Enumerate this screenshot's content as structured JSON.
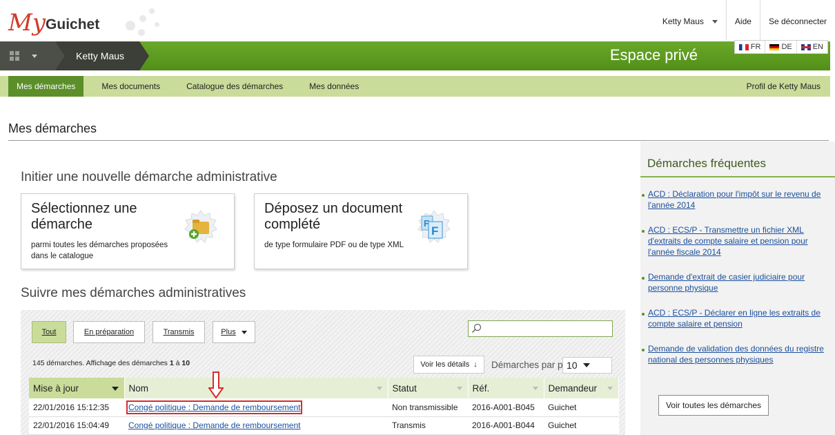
{
  "header": {
    "logo_my": "My",
    "logo_guichet": "Guichet",
    "user_name": "Ketty Maus",
    "help": "Aide",
    "logout": "Se déconnecter",
    "languages": [
      "FR",
      "DE",
      "EN"
    ]
  },
  "greenbar": {
    "user_pill": "Ketty Maus",
    "space_title": "Espace privé"
  },
  "nav": {
    "tabs": [
      "Mes démarches",
      "Mes documents",
      "Catalogue des démarches",
      "Mes données"
    ],
    "profile": "Profil de Ketty Maus"
  },
  "page_title": "Mes démarches",
  "new_section": {
    "heading": "Initier une nouvelle démarche administrative",
    "cards": [
      {
        "title": "Sélectionnez une démarche",
        "desc": "parmi toutes les démarches proposées dans le catalogue"
      },
      {
        "title": "Déposez un document complété",
        "desc": "de type formulaire PDF ou de type XML"
      }
    ]
  },
  "follow_section": {
    "heading": "Suivre mes démarches administratives",
    "filters": [
      "Tout",
      "En préparation",
      "Transmis",
      "Plus"
    ],
    "search_value": "",
    "count_prefix": "145 démarches. Affichage des démarches ",
    "count_from": "1",
    "count_sep": " à ",
    "count_to": "10",
    "details_btn": "Voir les détails",
    "per_page_label": "Démarches par page",
    "per_page_value": "10",
    "columns": [
      "Mise à jour",
      "Nom",
      "Statut",
      "Réf.",
      "Demandeur"
    ],
    "rows": [
      {
        "date": "22/01/2016 15:12:35",
        "name": "Congé politique : Demande de remboursement",
        "status": "Non transmissible",
        "ref": "2016-A001-B045",
        "requester": "Guichet"
      },
      {
        "date": "22/01/2016 15:04:49",
        "name": "Congé politique : Demande de remboursement",
        "status": "Transmis",
        "ref": "2016-A001-B044",
        "requester": "Guichet"
      }
    ]
  },
  "sidebar": {
    "title": "Démarches fréquentes",
    "links": [
      "ACD : Déclaration pour l'impôt sur le revenu de l'année 2014",
      "ACD : ECS/P - Transmettre un fichier XML d'extraits de compte salaire et pension pour l'année fiscale 2014",
      "Demande d'extrait de casier judiciaire pour personne physique",
      "ACD : ECS/P - Déclarer en ligne les extraits de compte salaire et pension",
      "Demande de validation des données du registre national des personnes physiques"
    ],
    "all_button": "Voir toutes les démarches"
  },
  "colors": {
    "brand_green": "#5c9a1e",
    "nav_green": "#c9dc9a",
    "highlight_red": "#d92b2b",
    "logo_red": "#d23b2a"
  }
}
